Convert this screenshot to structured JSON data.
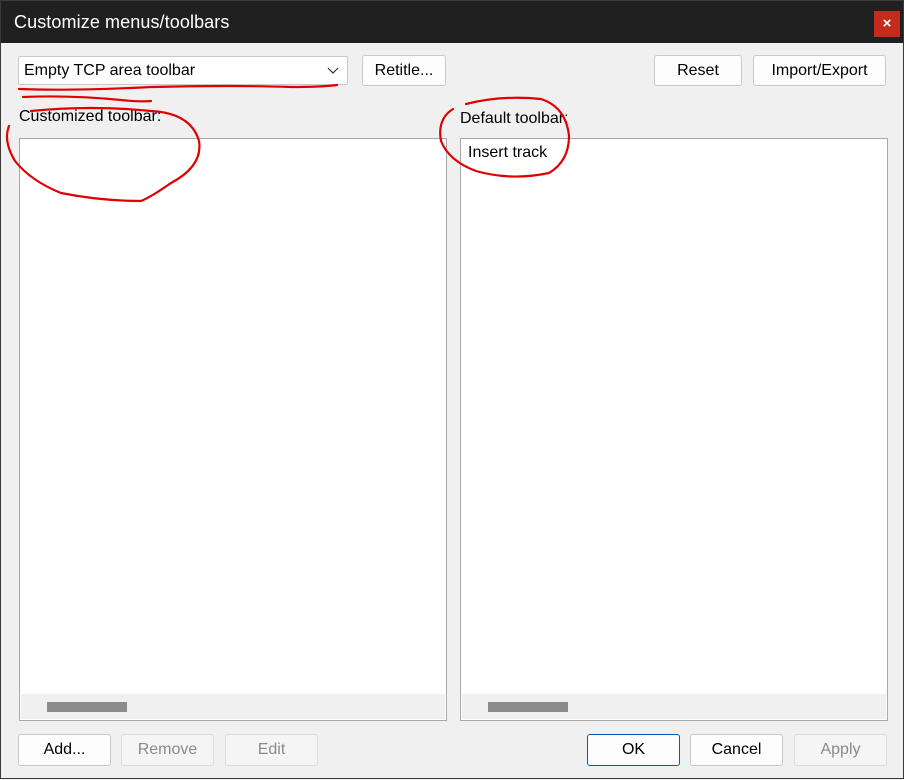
{
  "window": {
    "title": "Customize menus/toolbars",
    "close_glyph": "×"
  },
  "toolbar_select": {
    "value": "Empty TCP area toolbar",
    "icon": "chevron-down-icon"
  },
  "top_buttons": {
    "retitle": "Retitle...",
    "reset": "Reset",
    "import_export": "Import/Export"
  },
  "customized": {
    "label": "Customized toolbar:",
    "items": []
  },
  "default": {
    "label": "Default toolbar:",
    "items": [
      "Insert track"
    ]
  },
  "bottom_buttons": {
    "add": "Add...",
    "remove": "Remove",
    "edit": "Edit",
    "ok": "OK",
    "cancel": "Cancel",
    "apply": "Apply"
  },
  "colors": {
    "titlebar": "#202020",
    "close": "#c42b1c",
    "annotation": "#e00000",
    "accent": "#005fb8"
  }
}
